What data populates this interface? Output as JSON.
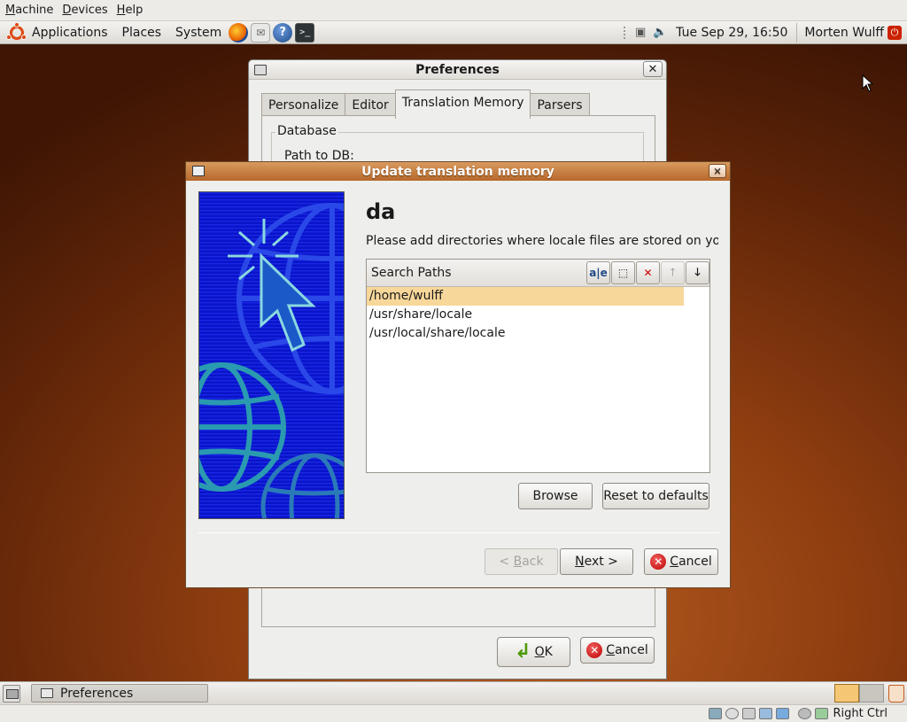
{
  "vbox_menu": {
    "items": [
      {
        "label_u": "M",
        "label_rest": "achine"
      },
      {
        "label_u": "D",
        "label_rest": "evices"
      },
      {
        "label_u": "H",
        "label_rest": "elp"
      }
    ]
  },
  "top_panel": {
    "applications": "Applications",
    "places": "Places",
    "system": "System",
    "clock": "Tue Sep 29, 16:50",
    "user": "Morten Wulff",
    "launchers": [
      "firefox-icon",
      "mail-icon",
      "help-icon",
      "terminal-icon"
    ]
  },
  "preferences": {
    "title": "Preferences",
    "tabs": [
      "Personalize",
      "Editor",
      "Translation Memory",
      "Parsers"
    ],
    "active_tab": "Translation Memory",
    "frame_label": "Database",
    "path_label": "Path to DB:",
    "ok_u": "O",
    "ok_rest": "K",
    "cancel_u": "C",
    "cancel_rest": "ancel"
  },
  "tm_dialog": {
    "title": "Update translation memory",
    "heading": "da",
    "description": "Please add directories where locale files are stored on your system.",
    "list_header": "Search Paths",
    "paths": [
      "/home/wulff",
      "/usr/share/locale",
      "/usr/local/share/locale"
    ],
    "selected_index": 0,
    "browse": "Browse",
    "reset": "Reset to defaults",
    "back_u": "B",
    "back_prefix": "< ",
    "back_rest": "ack",
    "next_u": "N",
    "next_rest": "ext >",
    "cancel_u": "C",
    "cancel_rest": "ancel"
  },
  "taskbar": {
    "window": "Preferences"
  },
  "vbox_status": {
    "host_key": "Right Ctrl"
  }
}
